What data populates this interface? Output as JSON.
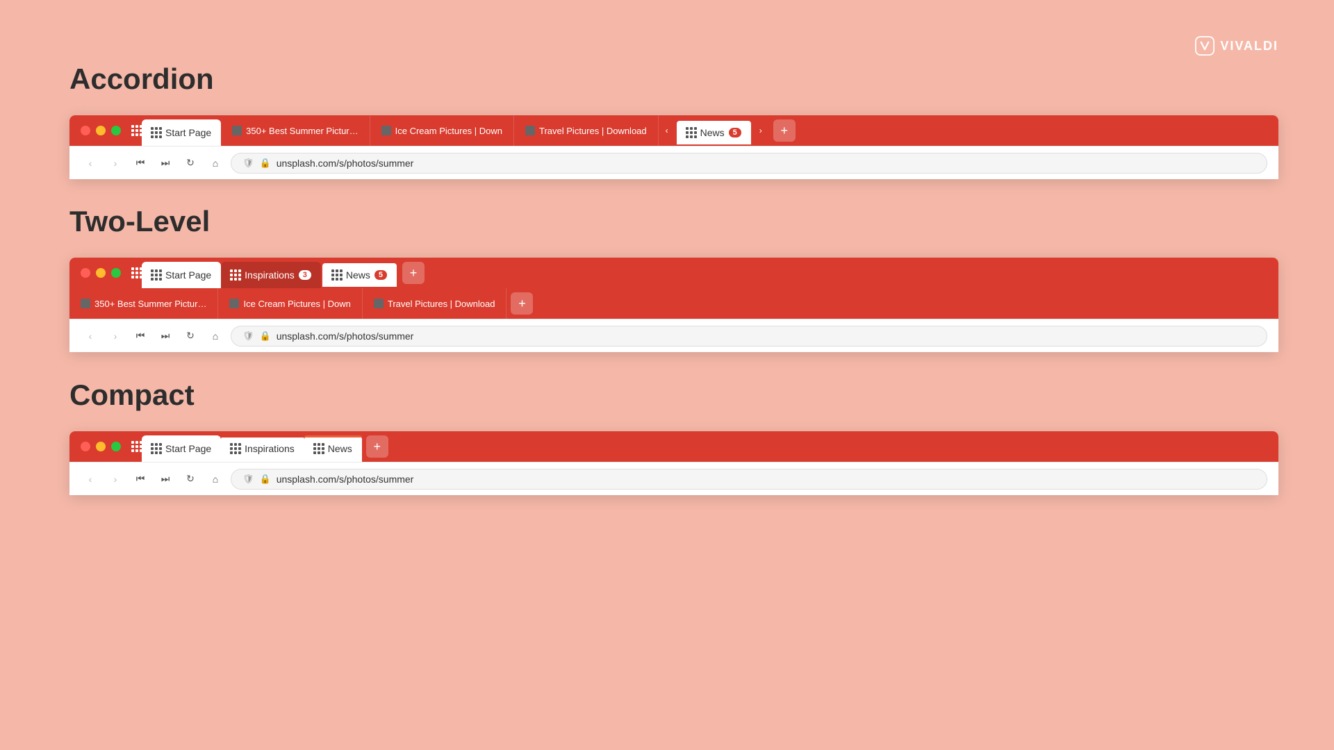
{
  "brand": {
    "name": "VIVALDI"
  },
  "sections": {
    "accordion": {
      "heading": "Accordion",
      "tabbar": {
        "tabs": [
          {
            "type": "start",
            "label": "Start Page"
          },
          {
            "type": "regular",
            "label": "350+ Best Summer Pictur…",
            "favicon": true
          },
          {
            "type": "regular",
            "label": "Ice Cream Pictures | Down",
            "favicon": true
          },
          {
            "type": "regular",
            "label": "Travel Pictures | Download",
            "favicon": true
          },
          {
            "type": "stack",
            "label": "News",
            "count": "5",
            "active": true
          }
        ]
      },
      "address": "unsplash.com/s/photos/summer"
    },
    "twolevel": {
      "heading": "Two-Level",
      "topbar": {
        "tabs": [
          {
            "type": "start",
            "label": "Start Page"
          },
          {
            "type": "stack",
            "label": "Inspirations",
            "count": "3",
            "active": false
          },
          {
            "type": "stack",
            "label": "News",
            "count": "5",
            "active": true
          }
        ]
      },
      "secondbar": {
        "tabs": [
          {
            "label": "350+ Best Summer Pictur…"
          },
          {
            "label": "Ice Cream Pictures | Down"
          },
          {
            "label": "Travel Pictures | Download"
          }
        ]
      },
      "address": "unsplash.com/s/photos/summer"
    },
    "compact": {
      "heading": "Compact",
      "tabbar": {
        "tabs": [
          {
            "type": "start",
            "label": "Start Page"
          },
          {
            "type": "stack-compact",
            "label": "Inspirations",
            "active": false
          },
          {
            "type": "stack-compact",
            "label": "News",
            "active": false
          }
        ]
      },
      "address": "unsplash.com/s/photos/summer"
    }
  },
  "nav": {
    "back": "‹",
    "forward": "›",
    "skip_back": "⏮",
    "skip_forward": "⏭",
    "reload": "↻",
    "home": "⌂"
  }
}
